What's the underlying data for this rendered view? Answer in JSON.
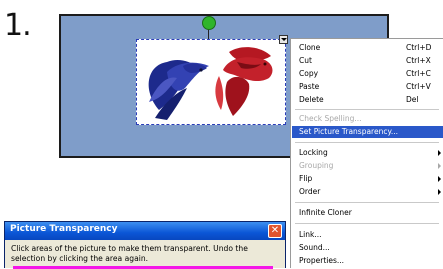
{
  "step": {
    "number": "1."
  },
  "canvas": {
    "background_color": "#7f9dc9",
    "handle_color": "#2fb52a"
  },
  "picture": {
    "description_icons": [
      "blue-betta-fish-icon",
      "red-betta-fish-icon"
    ]
  },
  "context_menu": {
    "items": [
      {
        "label": "Clone",
        "shortcut": "Ctrl+D"
      },
      {
        "label": "Cut",
        "shortcut": "Ctrl+X"
      },
      {
        "label": "Copy",
        "shortcut": "Ctrl+C"
      },
      {
        "label": "Paste",
        "shortcut": "Ctrl+V"
      },
      {
        "label": "Delete",
        "shortcut": "Del"
      },
      {
        "label": "Check Spelling..."
      },
      {
        "label": "Set Picture Transparency..."
      },
      {
        "label": "Locking"
      },
      {
        "label": "Grouping"
      },
      {
        "label": "Flip"
      },
      {
        "label": "Order"
      },
      {
        "label": "Infinite Cloner"
      },
      {
        "label": "Link..."
      },
      {
        "label": "Sound..."
      },
      {
        "label": "Properties..."
      }
    ],
    "highlight_color": "#2a58c9"
  },
  "dialog": {
    "title": "Picture Transparency",
    "close_glyph": "✕",
    "instruction": "Click areas of the picture to make them transparent. Undo the selection by clicking the area again.",
    "preview_color": "#f417e8"
  }
}
